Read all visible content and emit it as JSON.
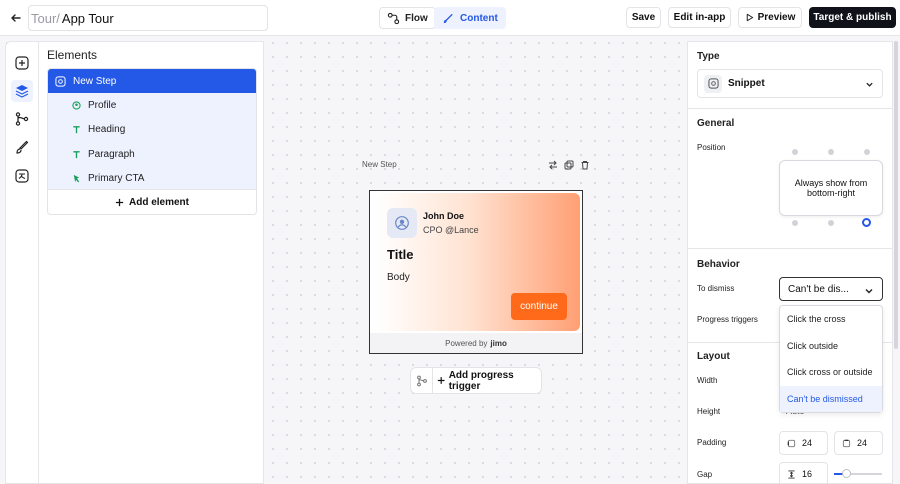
{
  "header": {
    "breadcrumb_prefix": "Tour/",
    "tour_name": "App Tour",
    "flow_label": "Flow",
    "content_label": "Content",
    "save_label": "Save",
    "edit_label": "Edit in-app",
    "preview_label": "Preview",
    "publish_label": "Target & publish"
  },
  "elements": {
    "title": "Elements",
    "step": "New Step",
    "children": [
      "Profile",
      "Heading",
      "Paragraph",
      "Primary CTA"
    ],
    "add_label": "Add element"
  },
  "preview": {
    "step_label": "New Step",
    "name": "John Doe",
    "role": "CPO @Lance",
    "title": "Title",
    "body": "Body",
    "cta": "continue",
    "powered_by": "Powered by",
    "brand": "jimo",
    "add_trigger": "Add progress trigger"
  },
  "settings": {
    "type_title": "Type",
    "type_value": "Snippet",
    "general_title": "General",
    "position_label": "Position",
    "position_tooltip": "Always show from bottom-right",
    "position_selected": "bottom-right",
    "behavior_title": "Behavior",
    "dismiss_label": "To dismiss",
    "dismiss_value": "Can't be dis...",
    "progress_label": "Progress triggers",
    "dismiss_options": [
      "Click the cross",
      "Click outside",
      "Click cross or outside",
      "Can't be dismissed"
    ],
    "dismiss_selected_index": 3,
    "layout_title": "Layout",
    "width_label": "Width",
    "height_label": "Height",
    "height_value": "Auto",
    "padding_label": "Padding",
    "padding_x": "24",
    "padding_y": "24",
    "gap_label": "Gap",
    "gap_value": "16",
    "gap_slider_fraction": 0.25
  },
  "colors": {
    "accent": "#2458e6",
    "cta": "#ff6a1a",
    "publish_bg": "#0f1219"
  }
}
